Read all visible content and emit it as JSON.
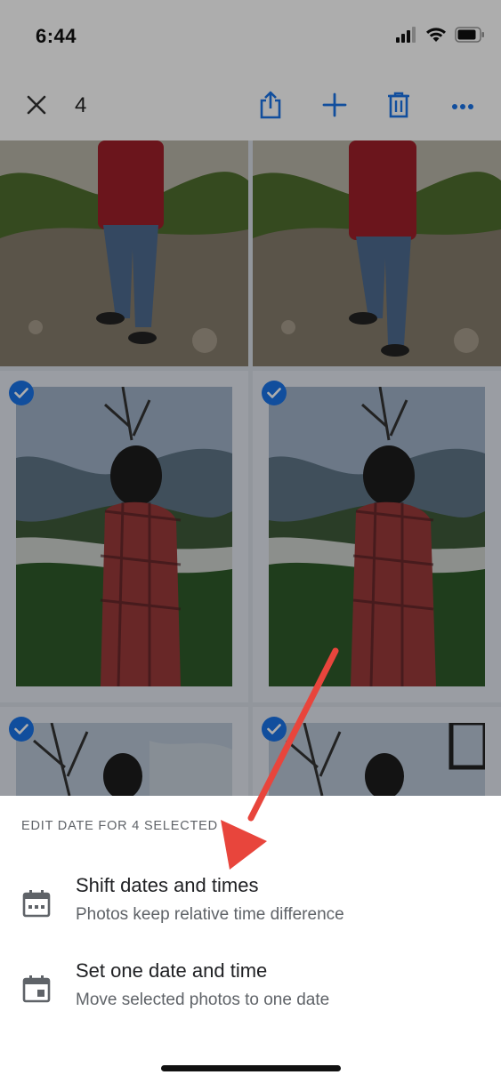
{
  "status_bar": {
    "time": "6:44",
    "icons": [
      "cellular-signal-icon",
      "wifi-icon",
      "battery-icon"
    ]
  },
  "toolbar": {
    "close_icon": "close-icon",
    "selected_count": "4",
    "actions": [
      "share-icon",
      "add-icon",
      "trash-icon",
      "more-icon"
    ],
    "accent_color": "#1a73e8"
  },
  "grid": {
    "selected_indicator_color": "#1a73e8",
    "check_icon": "check-icon"
  },
  "sheet": {
    "title": "EDIT DATE FOR 4 SELECTED",
    "options": [
      {
        "icon": "calendar-shift-icon",
        "title": "Shift dates and times",
        "subtitle": "Photos keep relative time difference"
      },
      {
        "icon": "calendar-event-icon",
        "title": "Set one date and time",
        "subtitle": "Move selected photos to one date"
      }
    ]
  },
  "annotation": {
    "arrow_color": "#e8453c"
  }
}
